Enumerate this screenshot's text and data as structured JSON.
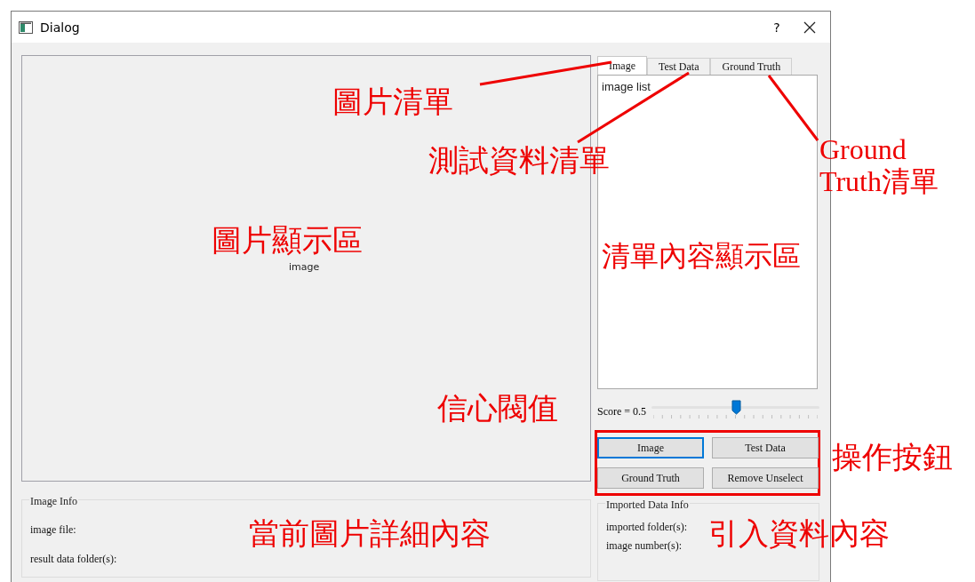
{
  "window": {
    "title": "Dialog",
    "help": "?"
  },
  "image_view": {
    "label": "image"
  },
  "tabs": [
    {
      "label": "Image",
      "selected": true
    },
    {
      "label": "Test Data",
      "selected": false
    },
    {
      "label": "Ground Truth",
      "selected": false
    }
  ],
  "list": {
    "text": "image list"
  },
  "slider": {
    "label": "Score = 0.5",
    "level": 0.5
  },
  "buttons_panel": {
    "highlighted": true,
    "buttons": [
      {
        "label": "Image",
        "focused": true
      },
      {
        "label": "Test Data",
        "focused": false
      },
      {
        "label": "Ground Truth",
        "focused": false
      },
      {
        "label": "Remove Unselect",
        "focused": false
      }
    ]
  },
  "image_info": {
    "title": "Image Info",
    "lines": [
      "image file:",
      "result data folder(s):"
    ]
  },
  "imported_info": {
    "title": "Imported Data Info",
    "lines": [
      "imported folder(s):",
      "image number(s):"
    ]
  },
  "annotations": [
    {
      "text": "圖片清單"
    },
    {
      "text": "測試資料清單"
    },
    {
      "text": "Ground Truth清單"
    },
    {
      "text": "圖片顯示區"
    },
    {
      "text": "清單內容顯示區"
    },
    {
      "text": "信心閥值"
    },
    {
      "text": "操作按鈕"
    },
    {
      "text": "當前圖片詳細內容"
    },
    {
      "text": "引入資料內容"
    }
  ]
}
